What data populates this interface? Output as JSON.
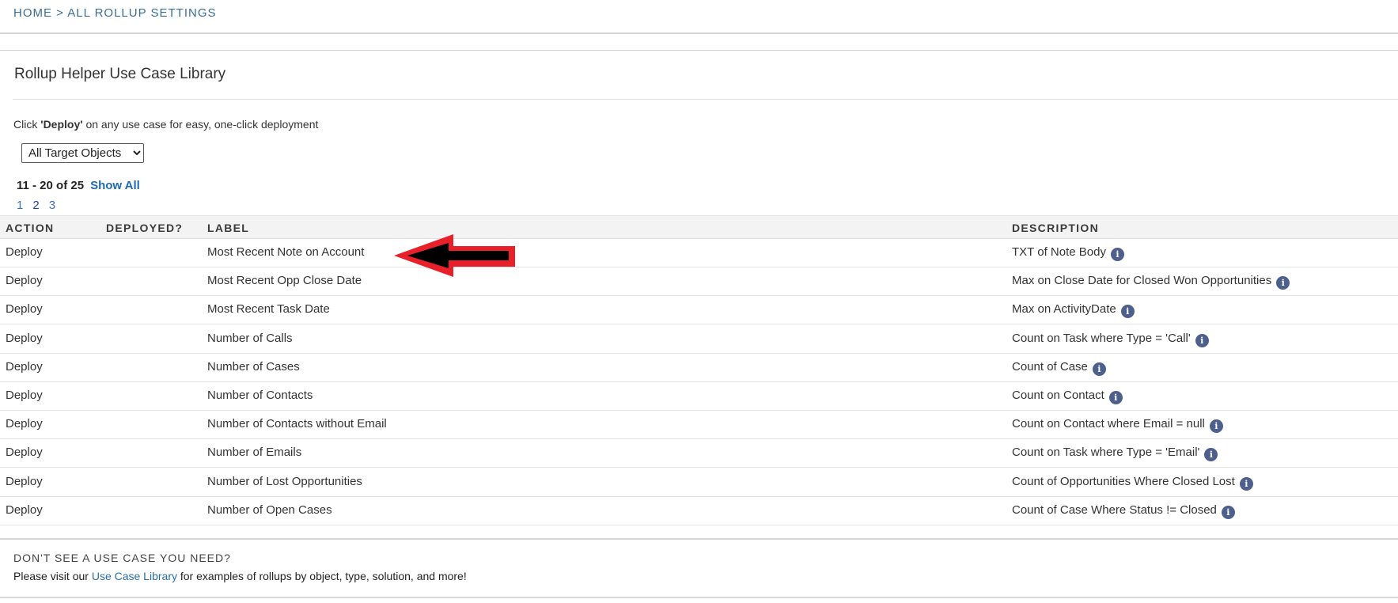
{
  "breadcrumb": {
    "home": "HOME",
    "separator": ">",
    "current": "ALL ROLLUP SETTINGS"
  },
  "page_title": "Rollup Helper Use Case Library",
  "instruction": {
    "prefix": "Click ",
    "bold": "'Deploy'",
    "suffix": " on any use case for easy, one-click deployment"
  },
  "filter": {
    "selected": "All Target Objects"
  },
  "pagination": {
    "range": "11 - 20 of 25",
    "show_all": "Show All",
    "pages": [
      "1",
      "2",
      "3"
    ]
  },
  "table": {
    "headers": {
      "action": "ACTION",
      "deployed": "DEPLOYED?",
      "label": "LABEL",
      "description": "DESCRIPTION"
    },
    "rows": [
      {
        "action": "Deploy",
        "deployed": "",
        "label": "Most Recent Note on Account",
        "description": "TXT of Note Body"
      },
      {
        "action": "Deploy",
        "deployed": "",
        "label": "Most Recent Opp Close Date",
        "description": "Max on Close Date for Closed Won Opportunities"
      },
      {
        "action": "Deploy",
        "deployed": "",
        "label": "Most Recent Task Date",
        "description": "Max on ActivityDate"
      },
      {
        "action": "Deploy",
        "deployed": "",
        "label": "Number of Calls",
        "description": "Count on Task where Type = 'Call'"
      },
      {
        "action": "Deploy",
        "deployed": "",
        "label": "Number of Cases",
        "description": "Count of Case"
      },
      {
        "action": "Deploy",
        "deployed": "",
        "label": "Number of Contacts",
        "description": "Count on Contact"
      },
      {
        "action": "Deploy",
        "deployed": "",
        "label": "Number of Contacts without Email",
        "description": "Count on Contact where Email = null"
      },
      {
        "action": "Deploy",
        "deployed": "",
        "label": "Number of Emails",
        "description": "Count on Task where Type = 'Email'"
      },
      {
        "action": "Deploy",
        "deployed": "",
        "label": "Number of Lost Opportunities",
        "description": "Count of Opportunities Where Closed Lost"
      },
      {
        "action": "Deploy",
        "deployed": "",
        "label": "Number of Open Cases",
        "description": "Count of Case Where Status != Closed"
      }
    ]
  },
  "footer": {
    "heading": "DON'T SEE A USE CASE YOU NEED?",
    "text_prefix": "Please visit our ",
    "link": "Use Case Library",
    "text_suffix": " for examples of rollups by object, type, solution, and more!"
  },
  "icons": {
    "info": "info-icon",
    "annotation": "arrow-left-icon"
  },
  "colors": {
    "link": "#2a6fa8",
    "info_icon": "#4d5f8c",
    "arrow_outer": "#e8202a",
    "arrow_inner": "#000000"
  }
}
